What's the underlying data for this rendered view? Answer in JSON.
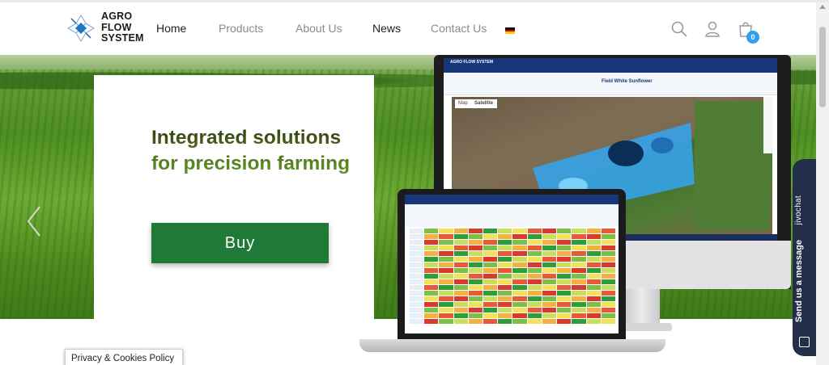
{
  "header": {
    "logo_lines": [
      "AGRO",
      "FLOW",
      "SYSTEM"
    ],
    "nav": [
      {
        "label": "Home",
        "active": true
      },
      {
        "label": "Products",
        "active": false
      },
      {
        "label": "About Us",
        "active": false
      },
      {
        "label": "News",
        "active": true
      },
      {
        "label": "Contact Us",
        "active": false
      }
    ],
    "language_flag": "de-flag-icon",
    "icons": [
      "search-icon",
      "user-icon",
      "cart-icon"
    ],
    "cart_count": "0"
  },
  "hero": {
    "headline": "Integrated solutions for precision farming",
    "buy_label": "Buy",
    "prev_icon": "chevron-left-icon",
    "next_icon": "chevron-right-icon"
  },
  "monitor": {
    "app_name": "AGRO FLOW SYSTEM",
    "field_title": "Field White Sunflower",
    "map_tabs": [
      "Map",
      "Satellite"
    ]
  },
  "chat": {
    "brand": "jivochat",
    "message": "Send us a message"
  },
  "privacy": {
    "label": "Privacy & Cookies Policy"
  },
  "colors": {
    "brand_green": "#1f7a37",
    "brand_navy": "#17377a",
    "badge_blue": "#2f9ff0",
    "chat_bg": "#232e4a"
  }
}
